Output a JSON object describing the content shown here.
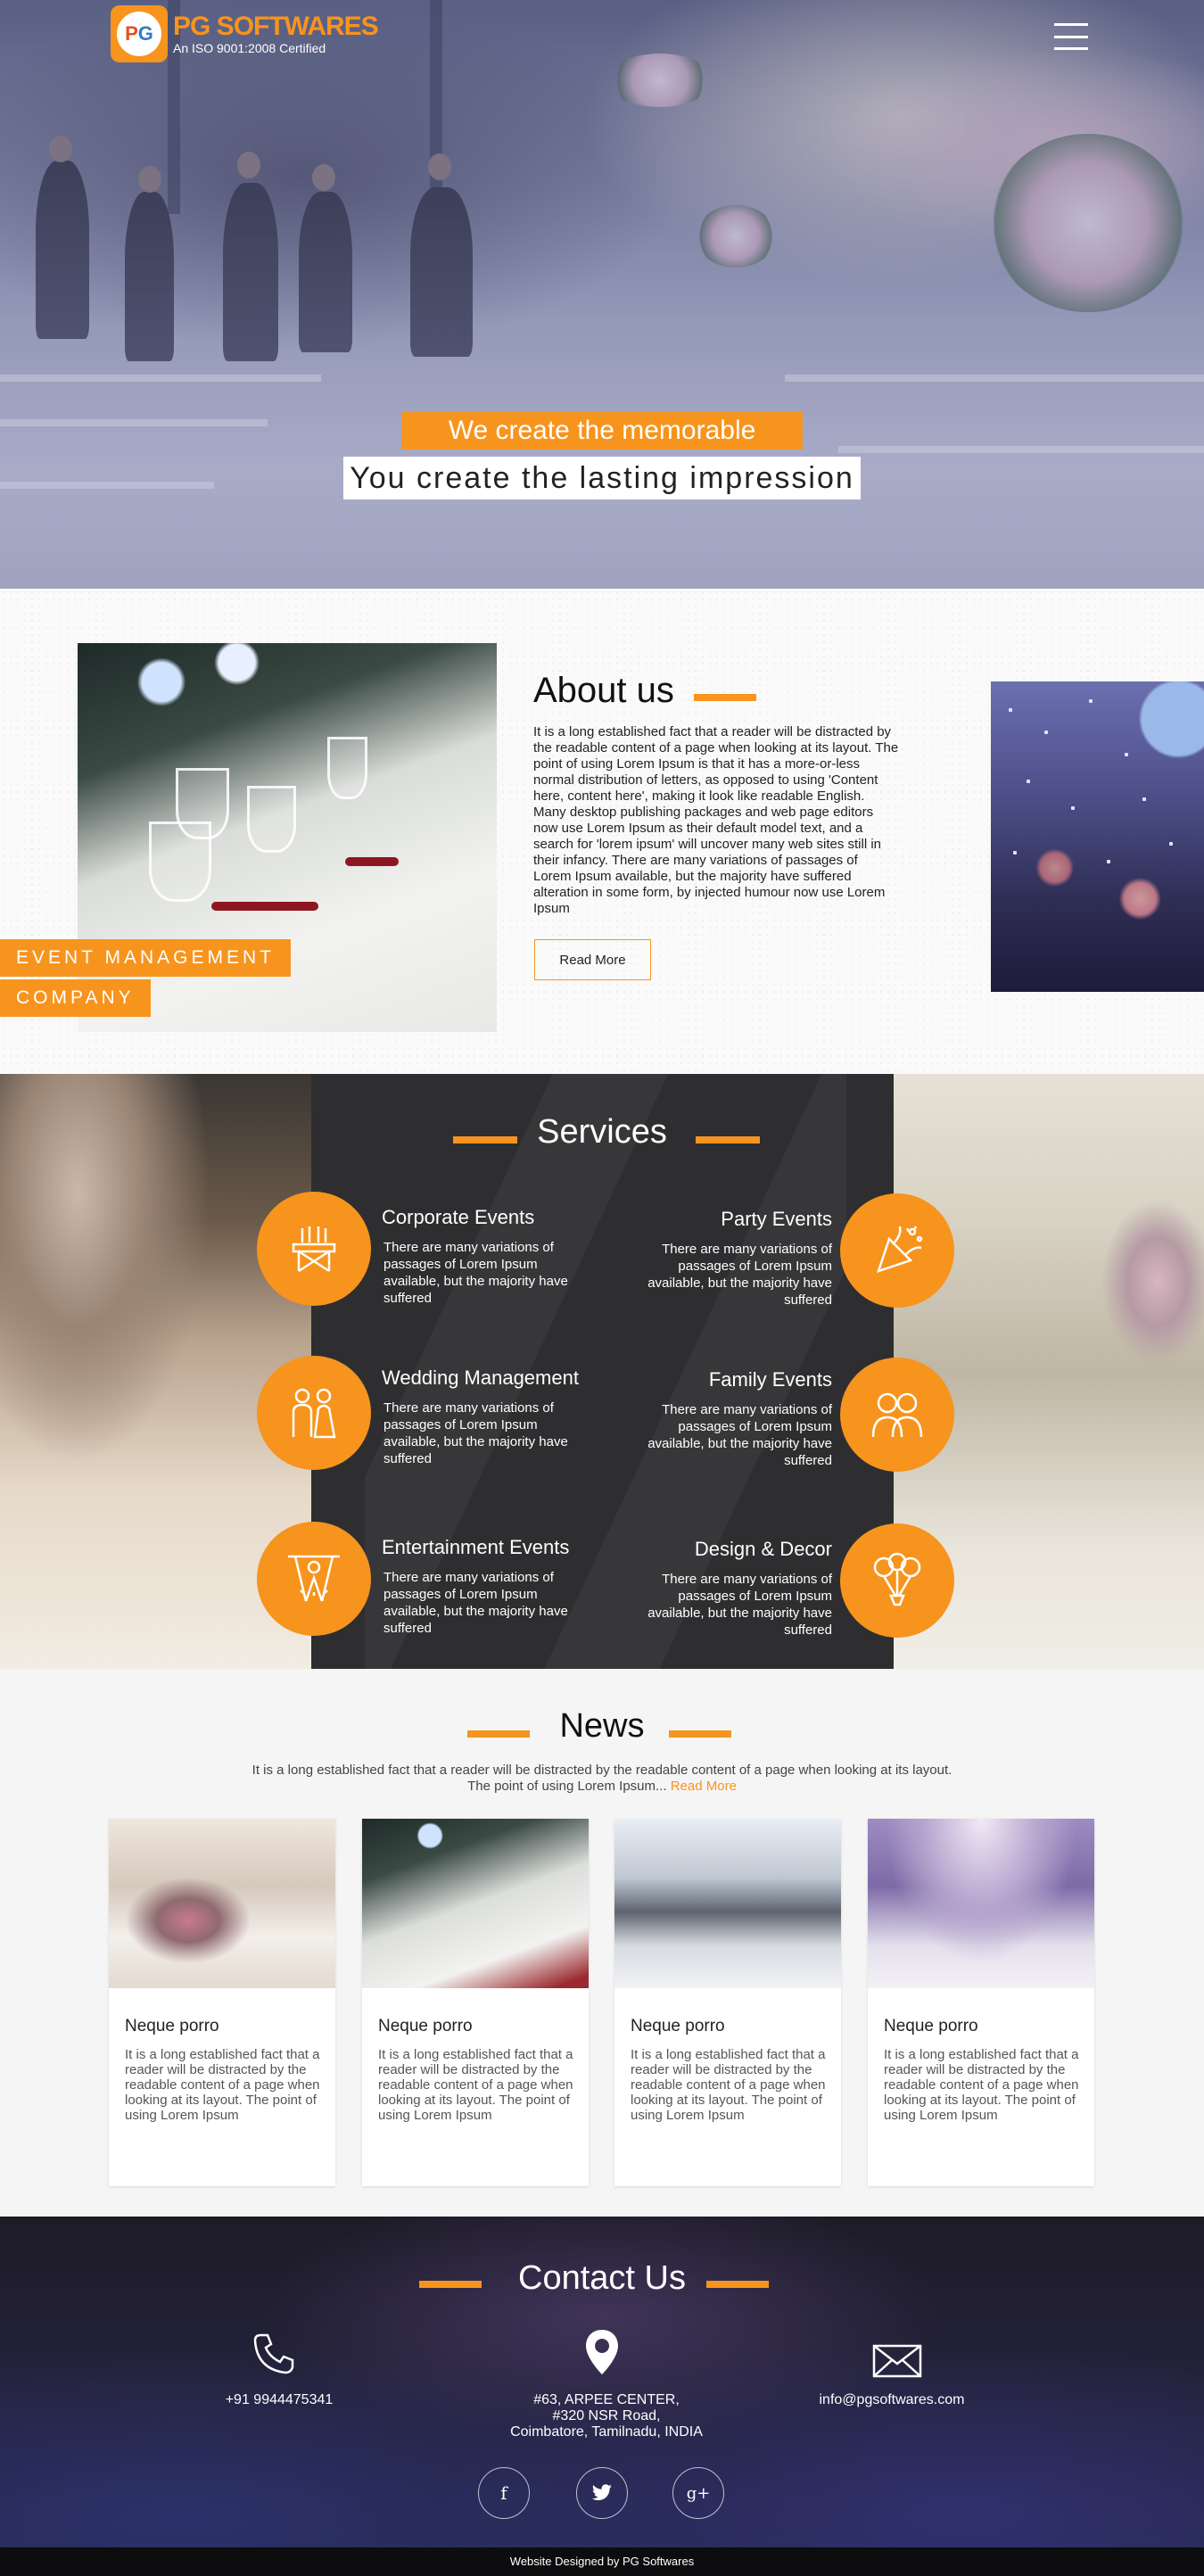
{
  "colors": {
    "accent": "#f7941d",
    "dark": "#2e2e30"
  },
  "header": {
    "brand": "PG SOFTWARES",
    "certification": "An ISO 9001:2008 Certified",
    "menu_icon": "hamburger-icon"
  },
  "hero": {
    "tagline_1": "We create the memorable event...",
    "tagline_2": "You create the lasting impression"
  },
  "about": {
    "badge_line_1": "EVENT MANAGEMENT",
    "badge_line_2": "COMPANY",
    "title": "About us",
    "text": "It is a long established fact that a reader will be distracted by the readable content of a page when looking at its layout. The point of using Lorem Ipsum is that it has a more-or-less normal distribution of letters, as opposed to using 'Content here, content here', making it look like readable English. Many desktop publishing packages and web page editors now use Lorem Ipsum as their default model text, and a search for 'lorem ipsum' will uncover many web sites still in their infancy. There are many variations of passages of Lorem Ipsum available, but the majority have suffered alteration in some form, by injected humour now use Lorem Ipsum",
    "read_more": "Read More"
  },
  "services": {
    "title": "Services",
    "items": [
      {
        "title": "Corporate Events",
        "text": "There are many variations of passages of Lorem Ipsum available, but the majority have suffered",
        "icon": "banquet-table-icon"
      },
      {
        "title": "Party Events",
        "text": "There are many variations of passages of Lorem Ipsum available, but the majority have suffered",
        "icon": "party-popper-icon"
      },
      {
        "title": "Wedding Management",
        "text": "There are many variations of passages of Lorem Ipsum available, but the majority have suffered",
        "icon": "bride-groom-icon"
      },
      {
        "title": "Family Events",
        "text": "There are many variations of passages of Lorem Ipsum available, but the majority have suffered",
        "icon": "family-icon"
      },
      {
        "title": "Entertainment Events",
        "text": "There are many variations of passages of Lorem Ipsum available, but the majority have suffered",
        "icon": "stage-spotlight-icon"
      },
      {
        "title": "Design & Decor",
        "text": "There are many variations of passages of Lorem Ipsum available, but the majority have suffered",
        "icon": "balloons-icon"
      }
    ]
  },
  "news": {
    "title": "News",
    "description": "It is a long established fact that a reader will be distracted by the readable content of a page when looking at its layout. The point of using Lorem Ipsum...",
    "read_more": "Read More",
    "cards": [
      {
        "title": "Neque porro",
        "text": "It is a long established fact that a reader will be distracted by the readable content of a page when looking at its layout. The point of using Lorem Ipsum"
      },
      {
        "title": "Neque porro",
        "text": "It is a long established fact that a reader will be distracted by the readable content of a page when looking at its layout. The point of using Lorem Ipsum"
      },
      {
        "title": "Neque porro",
        "text": "It is a long established fact that a reader will be distracted by the readable content of a page when looking at its layout. The point of using Lorem Ipsum"
      },
      {
        "title": "Neque porro",
        "text": "It is a long established fact that a reader will be distracted by the readable content of a page when looking at its layout. The point of using Lorem Ipsum"
      }
    ]
  },
  "contact": {
    "title": "Contact Us",
    "phone": "+91 9944475341",
    "address_line_1": "#63, ARPEE CENTER,",
    "address_line_2": "#320 NSR Road,",
    "address_line_3": "Coimbatore, Tamilnadu, INDIA",
    "email": "info@pgsoftwares.com",
    "social": [
      "f",
      "twitter",
      "g+"
    ]
  },
  "footer": {
    "text": "Website Designed by PG Softwares"
  }
}
